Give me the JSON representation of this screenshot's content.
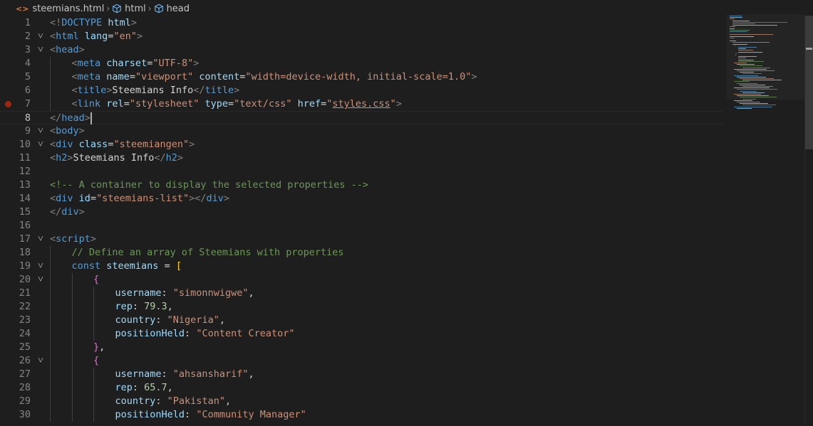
{
  "breadcrumb": {
    "file": "steemians.html",
    "file_icon": "html-file-icon",
    "items": [
      {
        "label": "html",
        "icon": "cube-icon"
      },
      {
        "label": "head",
        "icon": "cube-icon"
      }
    ]
  },
  "editor": {
    "current_line": 8,
    "breakpoint_line": 7,
    "lines": [
      {
        "n": "1",
        "fold": false,
        "indent": 0,
        "tokens": [
          [
            "t-tag",
            "<!"
          ],
          [
            "t-name",
            "DOCTYPE"
          ],
          [
            "t-text",
            " "
          ],
          [
            "t-attr",
            "html"
          ],
          [
            "t-tag",
            ">"
          ]
        ]
      },
      {
        "n": "2",
        "fold": true,
        "indent": 0,
        "tokens": [
          [
            "t-tag",
            "<"
          ],
          [
            "t-name",
            "html"
          ],
          [
            "t-text",
            " "
          ],
          [
            "t-attr",
            "lang"
          ],
          [
            "t-text",
            "="
          ],
          [
            "t-str",
            "\"en\""
          ],
          [
            "t-tag",
            ">"
          ]
        ]
      },
      {
        "n": "3",
        "fold": true,
        "indent": 0,
        "tokens": [
          [
            "t-tag",
            "<"
          ],
          [
            "t-name",
            "head"
          ],
          [
            "t-tag",
            ">"
          ]
        ]
      },
      {
        "n": "4",
        "fold": false,
        "indent": 1,
        "tokens": [
          [
            "t-tag",
            "<"
          ],
          [
            "t-name",
            "meta"
          ],
          [
            "t-text",
            " "
          ],
          [
            "t-attr",
            "charset"
          ],
          [
            "t-text",
            "="
          ],
          [
            "t-str",
            "\"UTF-8\""
          ],
          [
            "t-tag",
            ">"
          ]
        ]
      },
      {
        "n": "5",
        "fold": false,
        "indent": 1,
        "tokens": [
          [
            "t-tag",
            "<"
          ],
          [
            "t-name",
            "meta"
          ],
          [
            "t-text",
            " "
          ],
          [
            "t-attr",
            "name"
          ],
          [
            "t-text",
            "="
          ],
          [
            "t-str",
            "\"viewport\""
          ],
          [
            "t-text",
            " "
          ],
          [
            "t-attr",
            "content"
          ],
          [
            "t-text",
            "="
          ],
          [
            "t-str",
            "\"width=device-width, initial-scale=1.0\""
          ],
          [
            "t-tag",
            ">"
          ]
        ]
      },
      {
        "n": "6",
        "fold": false,
        "indent": 1,
        "tokens": [
          [
            "t-tag",
            "<"
          ],
          [
            "t-name",
            "title"
          ],
          [
            "t-tag",
            ">"
          ],
          [
            "t-text",
            "Steemians Info"
          ],
          [
            "t-tag",
            "</"
          ],
          [
            "t-name",
            "title"
          ],
          [
            "t-tag",
            ">"
          ]
        ]
      },
      {
        "n": "7",
        "fold": false,
        "indent": 1,
        "tokens": [
          [
            "t-tag",
            "<"
          ],
          [
            "t-name",
            "link"
          ],
          [
            "t-text",
            " "
          ],
          [
            "t-attr",
            "rel"
          ],
          [
            "t-text",
            "="
          ],
          [
            "t-str",
            "\"stylesheet\""
          ],
          [
            "t-text",
            " "
          ],
          [
            "t-attr",
            "type"
          ],
          [
            "t-text",
            "="
          ],
          [
            "t-str",
            "\"text/css\""
          ],
          [
            "t-text",
            " "
          ],
          [
            "t-attr",
            "href"
          ],
          [
            "t-text",
            "="
          ],
          [
            "t-str",
            "\""
          ],
          [
            "t-str t-link",
            "styles.css"
          ],
          [
            "t-str",
            "\""
          ],
          [
            "t-tag",
            ">"
          ]
        ]
      },
      {
        "n": "8",
        "fold": false,
        "indent": 0,
        "cursor": true,
        "tokens": [
          [
            "t-tag",
            "</"
          ],
          [
            "t-name",
            "head"
          ],
          [
            "t-tag",
            ">"
          ]
        ]
      },
      {
        "n": "9",
        "fold": true,
        "indent": 0,
        "tokens": [
          [
            "t-tag",
            "<"
          ],
          [
            "t-name",
            "body"
          ],
          [
            "t-tag",
            ">"
          ]
        ]
      },
      {
        "n": "10",
        "fold": true,
        "indent": 0,
        "tokens": [
          [
            "t-tag",
            "<"
          ],
          [
            "t-name",
            "div"
          ],
          [
            "t-text",
            " "
          ],
          [
            "t-attr",
            "class"
          ],
          [
            "t-text",
            "="
          ],
          [
            "t-str",
            "\"steemiangen\""
          ],
          [
            "t-tag",
            ">"
          ]
        ]
      },
      {
        "n": "11",
        "fold": false,
        "indent": 0,
        "tokens": [
          [
            "t-tag",
            "<"
          ],
          [
            "t-name",
            "h2"
          ],
          [
            "t-tag",
            ">"
          ],
          [
            "t-text",
            "Steemians Info"
          ],
          [
            "t-tag",
            "</"
          ],
          [
            "t-name",
            "h2"
          ],
          [
            "t-tag",
            ">"
          ]
        ]
      },
      {
        "n": "12",
        "fold": false,
        "indent": 0,
        "tokens": []
      },
      {
        "n": "13",
        "fold": false,
        "indent": 0,
        "tokens": [
          [
            "t-com",
            "<!-- A container to display the selected properties -->"
          ]
        ]
      },
      {
        "n": "14",
        "fold": false,
        "indent": 0,
        "tokens": [
          [
            "t-tag",
            "<"
          ],
          [
            "t-name",
            "div"
          ],
          [
            "t-text",
            " "
          ],
          [
            "t-attr",
            "id"
          ],
          [
            "t-text",
            "="
          ],
          [
            "t-str",
            "\"steemians-list\""
          ],
          [
            "t-tag",
            "></"
          ],
          [
            "t-name",
            "div"
          ],
          [
            "t-tag",
            ">"
          ]
        ]
      },
      {
        "n": "15",
        "fold": false,
        "indent": 0,
        "tokens": [
          [
            "t-tag",
            "</"
          ],
          [
            "t-name",
            "div"
          ],
          [
            "t-tag",
            ">"
          ]
        ]
      },
      {
        "n": "16",
        "fold": false,
        "indent": 0,
        "tokens": []
      },
      {
        "n": "17",
        "fold": true,
        "indent": 0,
        "tokens": [
          [
            "t-tag",
            "<"
          ],
          [
            "t-name",
            "script"
          ],
          [
            "t-tag",
            ">"
          ]
        ]
      },
      {
        "n": "18",
        "fold": false,
        "indent": 1,
        "tokens": [
          [
            "t-com",
            "// Define an array of Steemians with properties"
          ]
        ]
      },
      {
        "n": "19",
        "fold": true,
        "indent": 1,
        "tokens": [
          [
            "t-kw",
            "const"
          ],
          [
            "t-text",
            " "
          ],
          [
            "t-var",
            "steemians"
          ],
          [
            "t-text",
            " = "
          ],
          [
            "t-br1",
            "["
          ]
        ]
      },
      {
        "n": "20",
        "fold": true,
        "indent": 2,
        "tokens": [
          [
            "t-br2",
            "{"
          ]
        ]
      },
      {
        "n": "21",
        "fold": false,
        "indent": 3,
        "tokens": [
          [
            "t-var",
            "username"
          ],
          [
            "t-text",
            ": "
          ],
          [
            "t-str",
            "\"simonnwigwe\""
          ],
          [
            "t-text",
            ","
          ]
        ]
      },
      {
        "n": "22",
        "fold": false,
        "indent": 3,
        "tokens": [
          [
            "t-var",
            "rep"
          ],
          [
            "t-text",
            ": "
          ],
          [
            "t-num",
            "79.3"
          ],
          [
            "t-text",
            ","
          ]
        ]
      },
      {
        "n": "23",
        "fold": false,
        "indent": 3,
        "tokens": [
          [
            "t-var",
            "country"
          ],
          [
            "t-text",
            ": "
          ],
          [
            "t-str",
            "\"Nigeria\""
          ],
          [
            "t-text",
            ","
          ]
        ]
      },
      {
        "n": "24",
        "fold": false,
        "indent": 3,
        "tokens": [
          [
            "t-var",
            "positionHeld"
          ],
          [
            "t-text",
            ": "
          ],
          [
            "t-str",
            "\"Content Creator\""
          ]
        ]
      },
      {
        "n": "25",
        "fold": false,
        "indent": 2,
        "tokens": [
          [
            "t-br2",
            "}"
          ],
          [
            "t-text",
            ","
          ]
        ]
      },
      {
        "n": "26",
        "fold": true,
        "indent": 2,
        "tokens": [
          [
            "t-br2",
            "{"
          ]
        ]
      },
      {
        "n": "27",
        "fold": false,
        "indent": 3,
        "tokens": [
          [
            "t-var",
            "username"
          ],
          [
            "t-text",
            ": "
          ],
          [
            "t-str",
            "\"ahsansharif\""
          ],
          [
            "t-text",
            ","
          ]
        ]
      },
      {
        "n": "28",
        "fold": false,
        "indent": 3,
        "tokens": [
          [
            "t-var",
            "rep"
          ],
          [
            "t-text",
            ": "
          ],
          [
            "t-num",
            "65.7"
          ],
          [
            "t-text",
            ","
          ]
        ]
      },
      {
        "n": "29",
        "fold": false,
        "indent": 3,
        "tokens": [
          [
            "t-var",
            "country"
          ],
          [
            "t-text",
            ": "
          ],
          [
            "t-str",
            "\"Pakistan\""
          ],
          [
            "t-text",
            ","
          ]
        ]
      },
      {
        "n": "30",
        "fold": false,
        "indent": 3,
        "tokens": [
          [
            "t-var",
            "positionHeld"
          ],
          [
            "t-text",
            ": "
          ],
          [
            "t-str",
            "\"Community Manager\""
          ]
        ]
      }
    ]
  }
}
